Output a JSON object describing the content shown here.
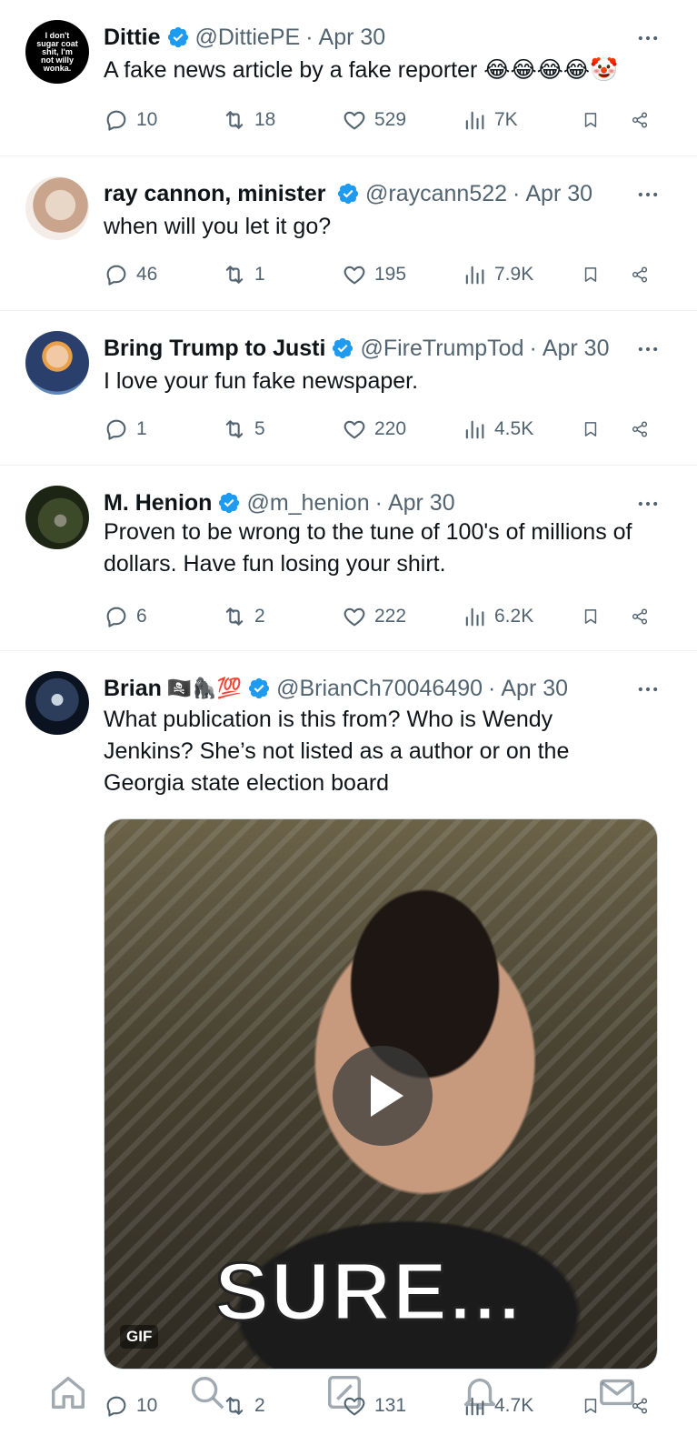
{
  "tweets": [
    {
      "name": "Dittie",
      "handle": "@DittiePE",
      "date": "Apr 30",
      "text": "A fake news article by a fake reporter 😂😂😂😂🤡",
      "avatar_text": "I don't sugar coat shit, I'm not willy wonka.",
      "replies": "10",
      "reposts": "18",
      "likes": "529",
      "views": "7K"
    },
    {
      "name": "ray cannon, minister c",
      "handle": "@raycann522",
      "date": "Apr 30",
      "text": "when will you let it go?",
      "replies": "46",
      "reposts": "1",
      "likes": "195",
      "views": "7.9K"
    },
    {
      "name": "Bring Trump to Justi",
      "handle": "@FireTrumpTod",
      "date": "Apr 30",
      "text": "I love your fun fake newspaper.",
      "replies": "1",
      "reposts": "5",
      "likes": "220",
      "views": "4.5K"
    },
    {
      "name": "M. Henion",
      "handle": "@m_henion",
      "date": "Apr 30",
      "text": "Proven to be wrong to the tune of 100's of millions of dollars. Have fun losing your shirt.",
      "replies": "6",
      "reposts": "2",
      "likes": "222",
      "views": "6.2K"
    },
    {
      "name": "Brian",
      "name_emoji": "🏴‍☠️🦍💯",
      "handle": "@BrianCh70046490",
      "date": "Apr 30",
      "text": "What publication is this from? Who is Wendy Jenkins? She’s not listed as a author or on the Georgia state election board",
      "media_caption": "SURE...",
      "media_badge": "GIF",
      "replies": "10",
      "reposts": "2",
      "likes": "131",
      "views": "4.7K"
    }
  ],
  "colors": {
    "text_primary": "#0f1419",
    "text_secondary": "#536471",
    "verified_blue": "#1d9bf0",
    "divider": "#eff3f4"
  },
  "icons": {
    "reply": "reply-icon",
    "repost": "repost-icon",
    "like": "like-icon",
    "views": "views-icon",
    "bookmark": "bookmark-icon",
    "share": "share-icon",
    "more": "more-icon",
    "verified": "verified-badge-icon"
  },
  "tabbar": [
    "home-icon",
    "search-icon",
    "compose-icon",
    "notifications-icon",
    "messages-icon"
  ]
}
